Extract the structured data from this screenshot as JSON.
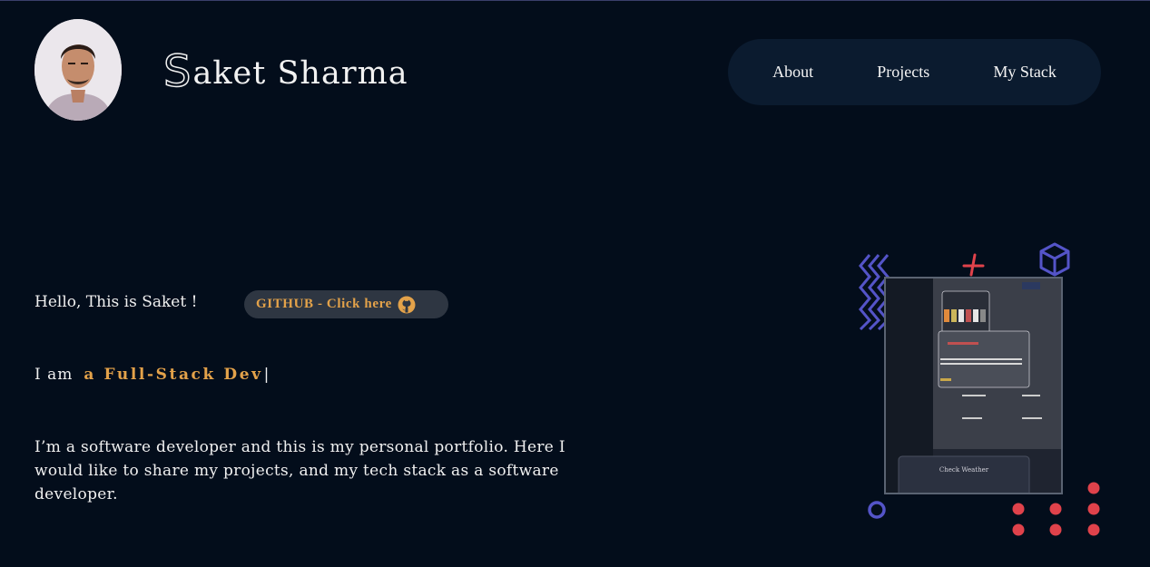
{
  "header": {
    "brand_initial": "S",
    "brand_rest": "aket Sharma",
    "nav": [
      "About",
      "Projects",
      "My Stack"
    ]
  },
  "hero": {
    "greeting": "Hello, This is Saket !",
    "github_label": "GITHUB - Click here",
    "iam_prefix": "I am",
    "role": "a Full-Stack Dev",
    "caret": "|",
    "bio": "I’m a software developer and this is my personal portfolio. Here I would like to share my projects, and my tech stack as a software developer."
  },
  "illustration": {
    "preview_card_label": "Check Weather"
  },
  "colors": {
    "background": "#030d1b",
    "nav_bg": "#0b1b2f",
    "accent_orange": "#e3a24a",
    "deco_blue": "#5454c8",
    "deco_red": "#e0424b"
  }
}
